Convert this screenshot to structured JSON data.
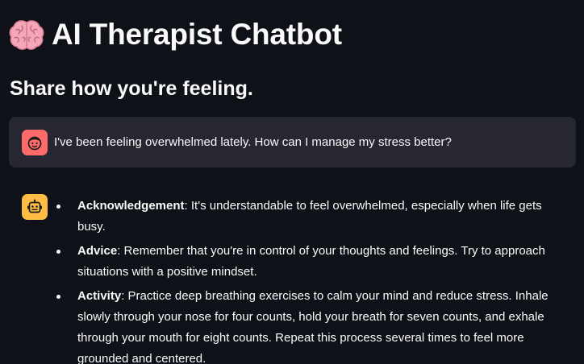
{
  "header": {
    "icon": "brain-icon",
    "title": "AI Therapist Chatbot",
    "subtitle": "Share how you're feeling."
  },
  "colors": {
    "background": "#0e1117",
    "user_bubble": "#262730",
    "user_avatar": "#ff6b6b",
    "bot_avatar": "#ffbd45"
  },
  "messages": {
    "user": {
      "avatar_icon": "user-face-icon",
      "text": "I've been feeling overwhelmed lately. How can I manage my stress better?"
    },
    "assistant": {
      "avatar_icon": "robot-face-icon",
      "items": [
        {
          "term": "Acknowledgement",
          "text": ": It's understandable to feel overwhelmed, especially when life gets busy."
        },
        {
          "term": "Advice",
          "text": ": Remember that you're in control of your thoughts and feelings. Try to approach situations with a positive mindset."
        },
        {
          "term": "Activity",
          "text": ": Practice deep breathing exercises to calm your mind and reduce stress. Inhale slowly through your nose for four counts, hold your breath for seven counts, and exhale through your mouth for eight counts. Repeat this process several times to feel more grounded and centered."
        }
      ]
    }
  }
}
